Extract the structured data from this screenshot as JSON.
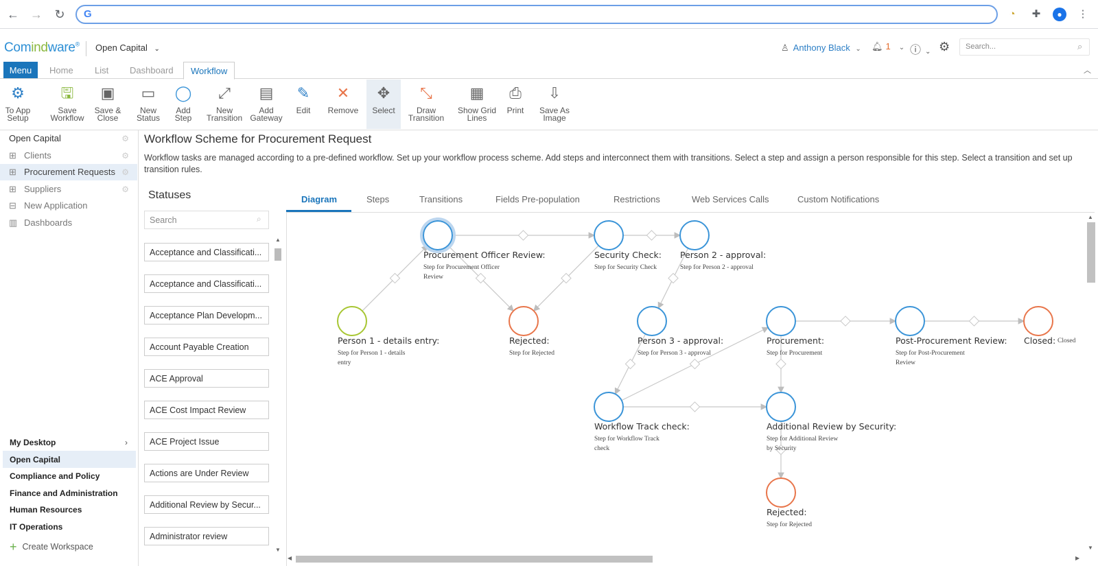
{
  "browser": {
    "address": "",
    "google_glyph": "G",
    "back": "←",
    "forward": "→",
    "reload": "↻"
  },
  "app": {
    "logo_part1": "Com",
    "logo_part2": "ind",
    "logo_part3": "ware",
    "logo_mark": "®",
    "workspace": "Open Capital",
    "user": "Anthony Black",
    "notifications": "1",
    "search_placeholder": "Search..."
  },
  "top_tabs": {
    "menu": "Menu",
    "home": "Home",
    "list": "List",
    "dashboard": "Dashboard",
    "workflow": "Workflow"
  },
  "ribbon": [
    {
      "id": "to-app-setup",
      "label1": "To App",
      "label2": "Setup",
      "icon": "⚙"
    },
    {
      "id": "save-workflow",
      "label1": "Save",
      "label2": "Workflow",
      "icon": "🖫"
    },
    {
      "id": "save-close",
      "label1": "Save &",
      "label2": "Close",
      "icon": "▣"
    },
    {
      "id": "new-status",
      "label1": "New",
      "label2": "Status",
      "icon": "▭"
    },
    {
      "id": "add-step",
      "label1": "Add",
      "label2": "Step",
      "icon": "◯"
    },
    {
      "id": "new-transition",
      "label1": "New",
      "label2": "Transition",
      "icon": "⤢"
    },
    {
      "id": "add-gateway",
      "label1": "Add",
      "label2": "Gateway",
      "icon": "▤"
    },
    {
      "id": "edit",
      "label1": "Edit",
      "label2": "",
      "icon": "✎"
    },
    {
      "id": "remove",
      "label1": "Remove",
      "label2": "",
      "icon": "✕"
    },
    {
      "id": "select",
      "label1": "Select",
      "label2": "",
      "icon": "✥"
    },
    {
      "id": "draw-transition",
      "label1": "Draw",
      "label2": "Transition",
      "icon": "⤡"
    },
    {
      "id": "show-grid-lines",
      "label1": "Show Grid",
      "label2": "Lines",
      "icon": "▦"
    },
    {
      "id": "print",
      "label1": "Print",
      "label2": "",
      "icon": "⎙"
    },
    {
      "id": "save-as-image",
      "label1": "Save As",
      "label2": "Image",
      "icon": "⇩"
    }
  ],
  "sidebar": {
    "items": [
      {
        "label": "Open Capital"
      },
      {
        "label": "Clients"
      },
      {
        "label": "Procurement Requests"
      },
      {
        "label": "Suppliers"
      },
      {
        "label": "New Application"
      },
      {
        "label": "Dashboards"
      }
    ],
    "workspaces": [
      {
        "label": "My Desktop"
      },
      {
        "label": "Open Capital"
      },
      {
        "label": "Compliance and Policy"
      },
      {
        "label": "Finance and Administration"
      },
      {
        "label": "Human Resources"
      },
      {
        "label": "IT Operations"
      }
    ],
    "create": "Create Workspace"
  },
  "main": {
    "title": "Workflow Scheme for Procurement Request",
    "description": "Workflow tasks are managed according to a pre-defined workflow. Set up your workflow process scheme. Add steps and interconnect them with transitions. Select a step and assign a person responsible for this step. Select a transition and set up transition rules."
  },
  "statuses": {
    "heading": "Statuses",
    "search_placeholder": "Search",
    "items": [
      "Acceptance and Classificati...",
      "Acceptance and Classificati...",
      "Acceptance Plan Developm...",
      "Account Payable Creation",
      "ACE Approval",
      "ACE Cost Impact Review",
      "ACE Project Issue",
      "Actions are Under Review",
      "Additional Review by Secur...",
      "Administrator review"
    ]
  },
  "diagram_tabs": [
    "Diagram",
    "Steps",
    "Transitions",
    "Fields Pre-population",
    "Restrictions",
    "Web Services Calls",
    "Custom Notifications"
  ],
  "nodes": [
    {
      "title": "Procurement Officer Review:",
      "sub1": "Step for Procurement Officer",
      "sub2": "Review",
      "color": "#3a94d8"
    },
    {
      "title": "Security Check:",
      "sub1": "Step for Security Check",
      "sub2": "",
      "color": "#3a94d8"
    },
    {
      "title": "Person 2 - approval:",
      "sub1": "Step for Person 2 - approval",
      "sub2": "",
      "color": "#3a94d8"
    },
    {
      "title": "Person 1 - details entry:",
      "sub1": "Step for Person 1 - details",
      "sub2": "entry",
      "color": "#a7c632"
    },
    {
      "title": "Rejected:",
      "sub1": "Step for Rejected",
      "sub2": "",
      "color": "#e8754a"
    },
    {
      "title": "Person 3 - approval:",
      "sub1": "Step for Person 3 - approval",
      "sub2": "",
      "color": "#3a94d8"
    },
    {
      "title": "Procurement:",
      "sub1": "Step for Procurement",
      "sub2": "",
      "color": "#3a94d8"
    },
    {
      "title": "Post-Procurement Review:",
      "sub1": "Step for Post-Procurement",
      "sub2": "Review",
      "color": "#3a94d8"
    },
    {
      "title": "Closed:",
      "sub1": "Closed",
      "sub2": "",
      "color": "#e8754a"
    },
    {
      "title": "Workflow Track check:",
      "sub1": "Step for Workflow Track",
      "sub2": "check",
      "color": "#3a94d8"
    },
    {
      "title": "Additional Review by Security:",
      "sub1": "Step for Additional Review",
      "sub2": "by Security",
      "color": "#3a94d8"
    },
    {
      "title": "Rejected:",
      "sub1": "Step for Rejected",
      "sub2": "",
      "color": "#e8754a"
    }
  ]
}
